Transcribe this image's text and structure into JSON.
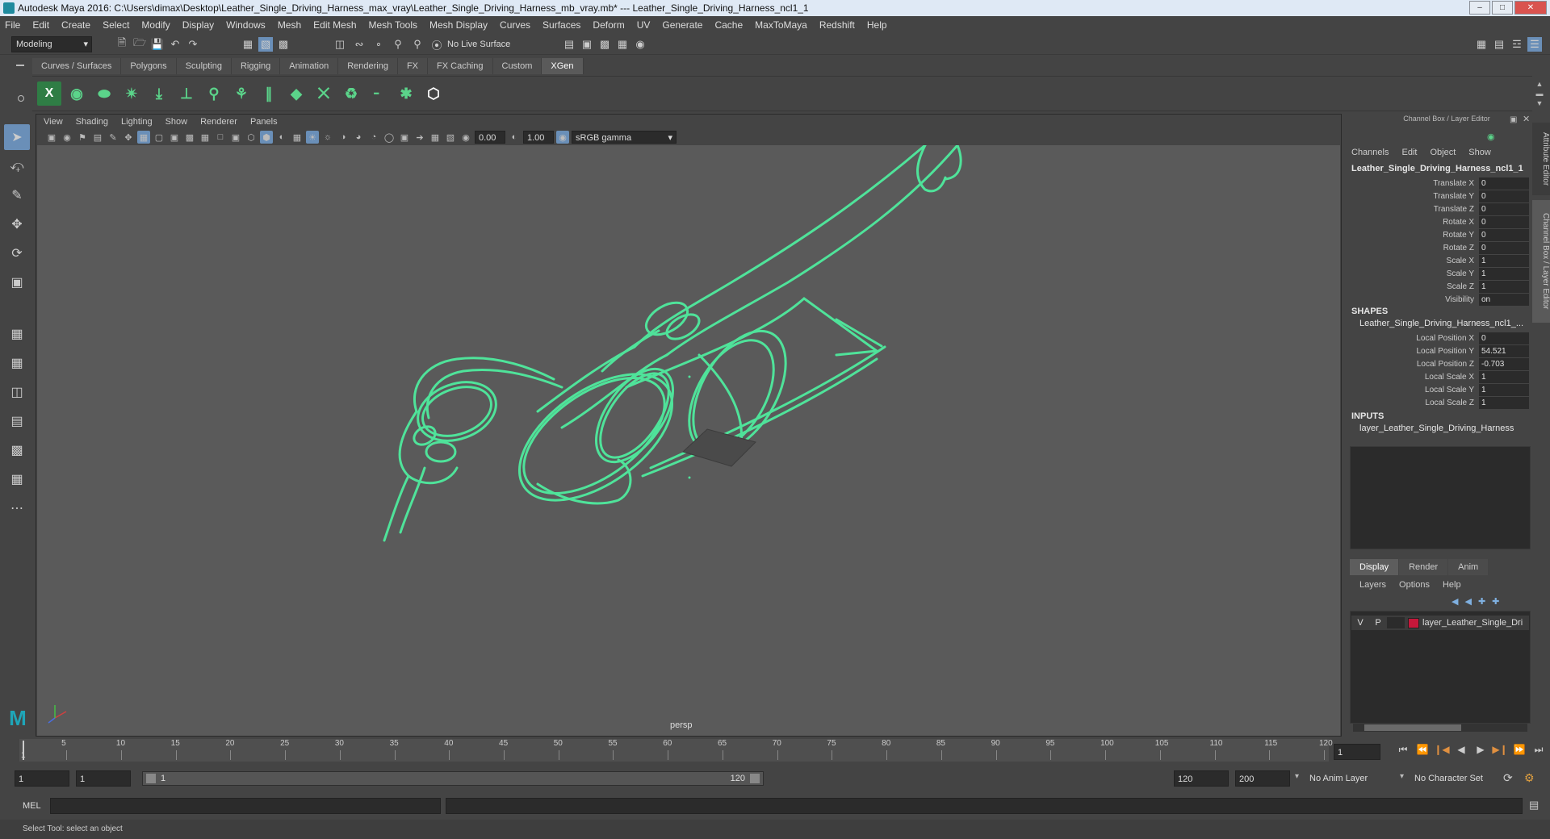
{
  "window": {
    "title": "Autodesk Maya 2016: C:\\Users\\dimax\\Desktop\\Leather_Single_Driving_Harness_max_vray\\Leather_Single_Driving_Harness_mb_vray.mb*   ---   Leather_Single_Driving_Harness_ncl1_1"
  },
  "menubar": [
    "File",
    "Edit",
    "Create",
    "Select",
    "Modify",
    "Display",
    "Windows",
    "Mesh",
    "Edit Mesh",
    "Mesh Tools",
    "Mesh Display",
    "Curves",
    "Surfaces",
    "Deform",
    "UV",
    "Generate",
    "Cache",
    "MaxToMaya",
    "Redshift",
    "Help"
  ],
  "statusline": {
    "mode": "Modeling",
    "live_surface": "No Live Surface"
  },
  "shelf": {
    "tabs": [
      "Curves / Surfaces",
      "Polygons",
      "Sculpting",
      "Rigging",
      "Animation",
      "Rendering",
      "FX",
      "FX Caching",
      "Custom",
      "XGen"
    ],
    "active": "XGen"
  },
  "panel": {
    "menu": [
      "View",
      "Shading",
      "Lighting",
      "Show",
      "Renderer",
      "Panels"
    ],
    "exposure": "0.00",
    "gamma": "1.00",
    "color_space": "sRGB gamma",
    "camera": "persp",
    "wire_color": "#4fe39a"
  },
  "channel_box": {
    "header": "Channel Box / Layer Editor",
    "menu": [
      "Channels",
      "Edit",
      "Object",
      "Show"
    ],
    "object": "Leather_Single_Driving_Harness_ncl1_1",
    "channels": [
      {
        "label": "Translate X",
        "value": "0"
      },
      {
        "label": "Translate Y",
        "value": "0"
      },
      {
        "label": "Translate Z",
        "value": "0"
      },
      {
        "label": "Rotate X",
        "value": "0"
      },
      {
        "label": "Rotate Y",
        "value": "0"
      },
      {
        "label": "Rotate Z",
        "value": "0"
      },
      {
        "label": "Scale X",
        "value": "1"
      },
      {
        "label": "Scale Y",
        "value": "1"
      },
      {
        "label": "Scale Z",
        "value": "1"
      },
      {
        "label": "Visibility",
        "value": "on"
      }
    ],
    "shapes_title": "SHAPES",
    "shape_name": "Leather_Single_Driving_Harness_ncl1_...",
    "shape_channels": [
      {
        "label": "Local Position X",
        "value": "0"
      },
      {
        "label": "Local Position Y",
        "value": "54.521"
      },
      {
        "label": "Local Position Z",
        "value": "-0.703"
      },
      {
        "label": "Local Scale X",
        "value": "1"
      },
      {
        "label": "Local Scale Y",
        "value": "1"
      },
      {
        "label": "Local Scale Z",
        "value": "1"
      }
    ],
    "inputs_title": "INPUTS",
    "input_name": "layer_Leather_Single_Driving_Harness"
  },
  "layer_editor": {
    "tabs": [
      "Display",
      "Render",
      "Anim"
    ],
    "active": "Display",
    "menu": [
      "Layers",
      "Options",
      "Help"
    ],
    "layer": {
      "v": "V",
      "p": "P",
      "name": "layer_Leather_Single_Dri",
      "color": "#c5173a"
    }
  },
  "side_tabs": [
    "Attribute Editor",
    "Channel Box / Layer Editor"
  ],
  "timeline": {
    "ticks": [
      "5",
      "10",
      "15",
      "20",
      "25",
      "30",
      "35",
      "40",
      "45",
      "50",
      "55",
      "60",
      "65",
      "70",
      "75",
      "80",
      "85",
      "90",
      "95",
      "100",
      "105",
      "110",
      "115",
      "120"
    ],
    "start_marker": "1",
    "current_frame": "1"
  },
  "range": {
    "start": "1",
    "anim_start": "1",
    "range_min": "1",
    "range_max": "120",
    "end": "120",
    "anim_end": "200",
    "anim_layer": "No Anim Layer",
    "char_set": "No Character Set"
  },
  "command": {
    "label": "MEL"
  },
  "help_line": "Select Tool: select an object"
}
